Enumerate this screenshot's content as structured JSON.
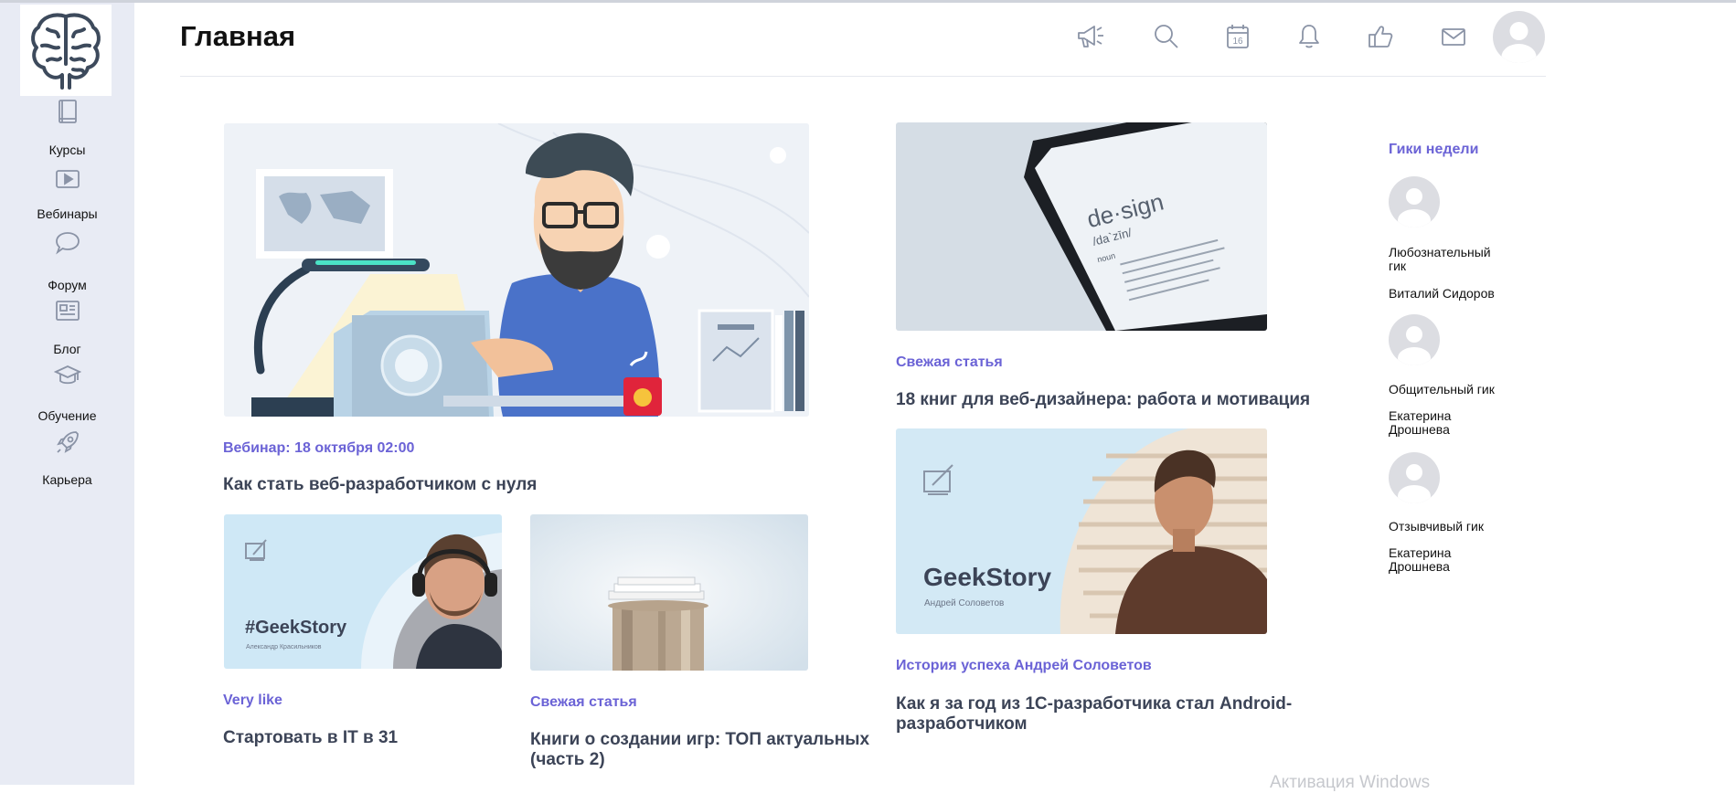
{
  "header": {
    "title": "Главная"
  },
  "sidebar": {
    "items": [
      {
        "label": "Курсы",
        "icon": "book-icon"
      },
      {
        "label": "Вебинары",
        "icon": "video-play-icon"
      },
      {
        "label": "Форум",
        "icon": "chat-bubble-icon"
      },
      {
        "label": "Блог",
        "icon": "newspaper-icon"
      },
      {
        "label": "Обучение",
        "icon": "graduation-cap-icon"
      },
      {
        "label": "Карьера",
        "icon": "rocket-icon"
      }
    ]
  },
  "toolbar_icons": [
    "megaphone-icon",
    "search-icon",
    "calendar-icon",
    "bell-icon",
    "thumbs-up-icon",
    "mail-icon",
    "user-avatar"
  ],
  "calendar_day": "16",
  "feed": {
    "main": {
      "tag": "Вебинар: 18 октября 02:00",
      "title": "Как стать веб-разработчиком с нуля"
    },
    "card2": {
      "tag": "Very like",
      "title": "Стартовать в IT в 31",
      "img_title": "#GeekStory",
      "img_sub": "Александр Красильников"
    },
    "card3": {
      "tag": "Свежая статья",
      "title": "Книги о создании игр: ТОП актуальных (часть 2)"
    },
    "card4": {
      "tag": "Свежая статья",
      "title": "18 книг для веб-дизайнера: работа и мотивация",
      "img_word": "de·sign",
      "img_phon": "/da`zīn/",
      "img_pos": "noun"
    },
    "card5": {
      "tag": "История успеха Андрей Соловетов",
      "title": "Как я за год из 1С-разработчика стал Android-разработчиком",
      "img_title": "GeekStory",
      "img_sub": "Андрей Соловетов"
    }
  },
  "geeks": {
    "title": "Гики недели",
    "items": [
      {
        "role": "Любознательный гик",
        "name": "Виталий Сидоров"
      },
      {
        "role": "Общительный гик",
        "name": "Екатерина Дрошнева"
      },
      {
        "role": "Отзывчивый гик",
        "name": "Екатерина Дрошнева"
      }
    ]
  },
  "watermark": "Активация Windows",
  "colors": {
    "accent": "#6b63d6",
    "sidebar_bg": "#e8ebf4",
    "title": "#3c4457",
    "icon": "#8a93a6"
  }
}
